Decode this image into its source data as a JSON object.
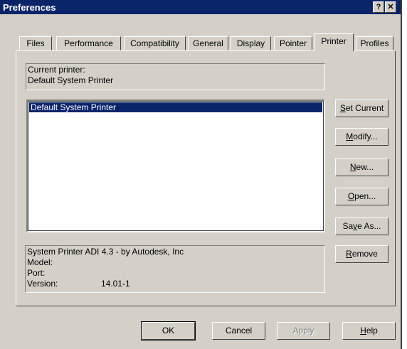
{
  "window": {
    "title": "Preferences",
    "help_glyph": "?",
    "close_glyph": "✕"
  },
  "tabs": [
    {
      "label": "Files"
    },
    {
      "label": "Performance"
    },
    {
      "label": "Compatibility"
    },
    {
      "label": "General"
    },
    {
      "label": "Display"
    },
    {
      "label": "Pointer"
    },
    {
      "label": "Printer",
      "active": true
    },
    {
      "label": "Profiles"
    }
  ],
  "current_printer": {
    "heading": "Current printer:",
    "value": "Default System Printer"
  },
  "printer_list": {
    "items": [
      "Default System Printer"
    ],
    "selected": "Default System Printer"
  },
  "side_buttons": [
    {
      "pre": "",
      "key": "S",
      "post": "et Current"
    },
    {
      "pre": "",
      "key": "M",
      "post": "odify..."
    },
    {
      "pre": "",
      "key": "N",
      "post": "ew..."
    },
    {
      "pre": "",
      "key": "O",
      "post": "pen..."
    },
    {
      "pre": "Sa",
      "key": "v",
      "post": "e As..."
    },
    {
      "pre": "",
      "key": "R",
      "post": "emove"
    }
  ],
  "details": {
    "description": "System Printer ADI 4.3 - by Autodesk, Inc",
    "model_label": "Model:",
    "port_label": "Port:",
    "version_label": "Version:",
    "version_value": "14.01-1"
  },
  "bottom_buttons": {
    "ok": "OK",
    "cancel": "Cancel",
    "apply": "Apply",
    "help_key": "H",
    "help_rest": "elp"
  },
  "colors": {
    "titlebar": "#0a246a",
    "face": "#d4d0c8",
    "selection": "#0a246a"
  }
}
